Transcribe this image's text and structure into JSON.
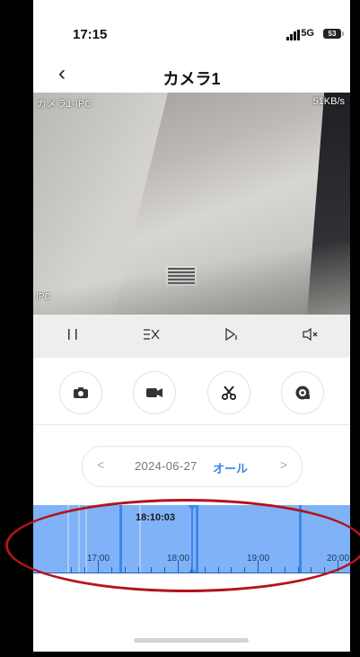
{
  "status_bar": {
    "time": "17:15",
    "network": "5G",
    "battery": "53"
  },
  "nav": {
    "back_icon": "chevron-left-icon",
    "title": "カメラ1"
  },
  "video": {
    "camera_label": "カメラ1-IPC",
    "bitrate": "51KB/s",
    "corner_label": "IPC"
  },
  "controls": [
    {
      "name": "pause",
      "glyph": "| |"
    },
    {
      "name": "speed",
      "glyph": "≡X"
    },
    {
      "name": "step",
      "glyph": "▷|"
    },
    {
      "name": "mute",
      "glyph": "◁×"
    }
  ],
  "actions": [
    {
      "name": "snapshot",
      "icon": "camera-icon",
      "glyph": "📷"
    },
    {
      "name": "record",
      "icon": "video-camera-icon",
      "glyph": "🎥"
    },
    {
      "name": "clip",
      "icon": "scissors-icon",
      "glyph": "✂"
    },
    {
      "name": "speed-play",
      "icon": "speed-icon",
      "glyph": "⚙"
    }
  ],
  "date_selector": {
    "prev": "<",
    "date": "2024-06-27",
    "filter": "オール",
    "next": ">"
  },
  "timeline": {
    "current_time": "18:10:03",
    "hours": [
      "17:00",
      "18:00",
      "19:00",
      "20:00"
    ]
  },
  "colors": {
    "accent": "#3a83e8",
    "timeline": "#7fb2f6",
    "annotation": "#b2141b"
  }
}
